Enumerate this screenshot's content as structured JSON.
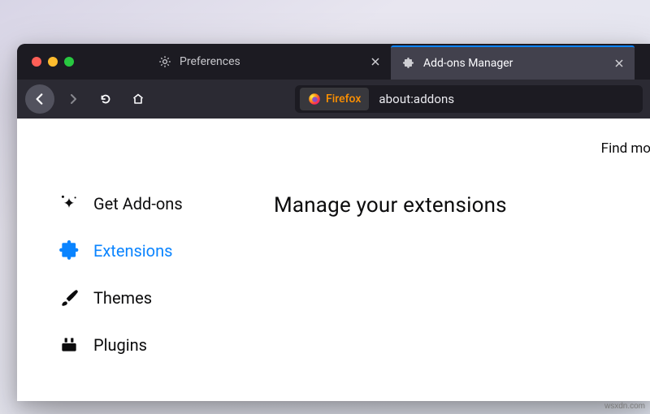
{
  "window": {
    "tabs": [
      {
        "icon": "gear",
        "label": "Preferences",
        "active": false
      },
      {
        "icon": "puzzle",
        "label": "Add-ons Manager",
        "active": true
      }
    ]
  },
  "toolbar": {
    "identity_label": "Firefox",
    "url": "about:addons"
  },
  "content": {
    "top_link": "Find mo",
    "sidebar": {
      "items": [
        {
          "icon": "sparkle",
          "label": "Get Add-ons",
          "selected": false
        },
        {
          "icon": "puzzle",
          "label": "Extensions",
          "selected": true
        },
        {
          "icon": "brush",
          "label": "Themes",
          "selected": false
        },
        {
          "icon": "plug",
          "label": "Plugins",
          "selected": false
        }
      ]
    },
    "heading": "Manage your extensions"
  },
  "watermark": "wsxdn.com"
}
